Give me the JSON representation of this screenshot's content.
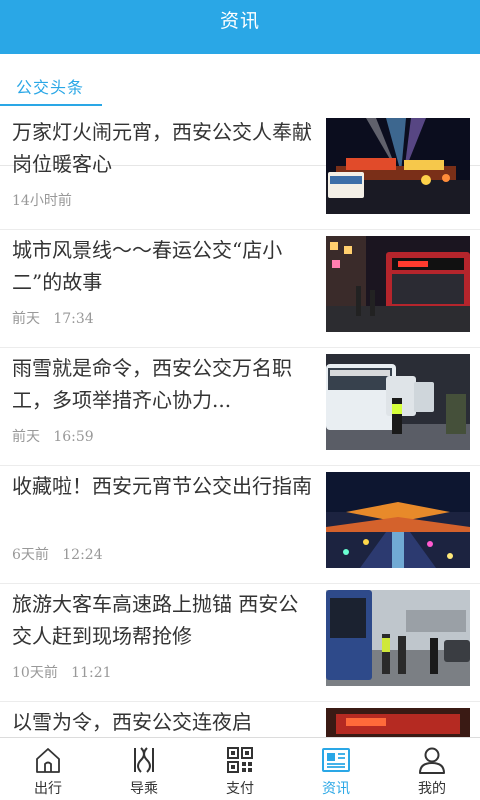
{
  "header": {
    "title": "资讯"
  },
  "category_tab": {
    "label": "公交头条"
  },
  "news": [
    {
      "title": "万家灯火闹元宵，西安公交人奉献岗位暖客心",
      "time": "14小时前"
    },
    {
      "title": "城市风景线～～春运公交“店小二”的故事",
      "time": "前天   17:34"
    },
    {
      "title": "雨雪就是命令，西安公交万名职工，多项举措齐心协力...",
      "time": "前天   16:59"
    },
    {
      "title": "收藏啦！西安元宵节公交出行指南",
      "time": "6天前   12:24"
    },
    {
      "title": "旅游大客车高速路上抛锚 西安公交人赶到现场帮抢修",
      "time": "10天前   11:21"
    },
    {
      "title": "以雪为令，西安公交连夜启",
      "time": ""
    }
  ],
  "bottom_nav": [
    {
      "label": "出行",
      "icon": "home-icon"
    },
    {
      "label": "导乘",
      "icon": "route-icon"
    },
    {
      "label": "支付",
      "icon": "qr-code-icon"
    },
    {
      "label": "资讯",
      "icon": "news-icon"
    },
    {
      "label": "我的",
      "icon": "user-icon"
    }
  ],
  "colors": {
    "accent": "#2aa7e6",
    "text": "#333333",
    "meta": "#999999"
  }
}
